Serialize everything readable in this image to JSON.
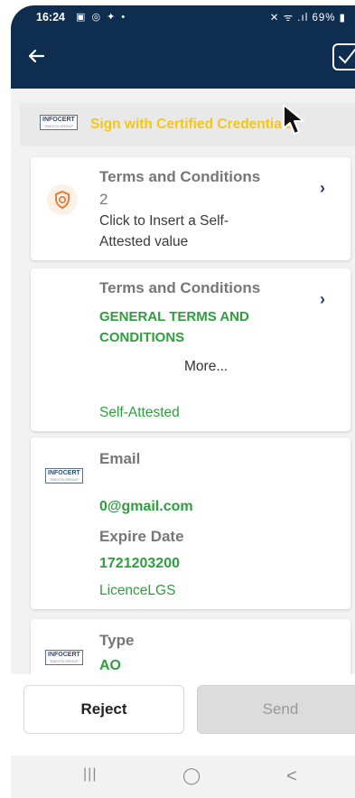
{
  "status_bar": {
    "time": "16:24",
    "notification_icons": "▣ ◎ ✦ •",
    "right_icons": "✕ ᯤ .ıl 69% ▮"
  },
  "app_bar": {
    "back_icon": "arrow-left-icon",
    "action_icon": "checkbox-icon"
  },
  "issuer": {
    "logo_text": "INFOCERT",
    "logo_sub": "TINEXTA GROUP",
    "title": "Sign with Certified Credentials"
  },
  "cards": [
    {
      "label": "Terms and Conditions",
      "label_line2": "2",
      "hint_line1": "Click to Insert a Self-",
      "hint_line2": "Attested value"
    },
    {
      "label": "Terms and Conditions",
      "value_line1": "GENERAL TERMS AND",
      "value_line2": "CONDITIONS",
      "more": "More...",
      "source": "Self-Attested"
    },
    {
      "label_email": "Email",
      "email_value": "0@gmail.com",
      "label_expire": "Expire Date",
      "expire_value": "1721203200",
      "source": "LicenceLGS"
    },
    {
      "label_type": "Type",
      "type_value": "AO"
    }
  ],
  "buttons": {
    "reject": "Reject",
    "send": "Send"
  },
  "nav": {
    "recent": "|||",
    "home": "◯",
    "back": "<"
  },
  "colors": {
    "app_bar": "#0f2d4f",
    "accent_yellow": "#f5c518",
    "value_green": "#2e9e3e"
  }
}
